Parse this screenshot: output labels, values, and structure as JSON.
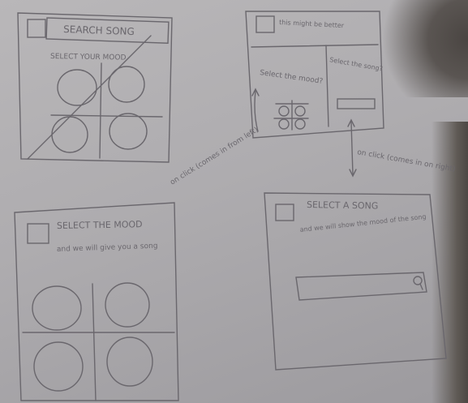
{
  "screens": {
    "topleft": {
      "title": "SEARCH SONG",
      "subtitle": "SELECT YOUR MOOD"
    },
    "topright": {
      "header_note": "this might be better",
      "select_mood": "Select the mood?",
      "select_song": "Select the song?"
    },
    "bottomleft": {
      "title": "SELECT THE MOOD",
      "subtitle": "and we will give you a song"
    },
    "bottomright": {
      "title": "SELECT A SONG",
      "subtitle": "and we will show the mood of the song"
    }
  },
  "annotations": {
    "left_arrow": "on click (comes in from left)",
    "right_arrow": "on click (comes in on right)"
  },
  "colors": {
    "pencil": "#6a676d",
    "paper": "#b5b3b6"
  }
}
